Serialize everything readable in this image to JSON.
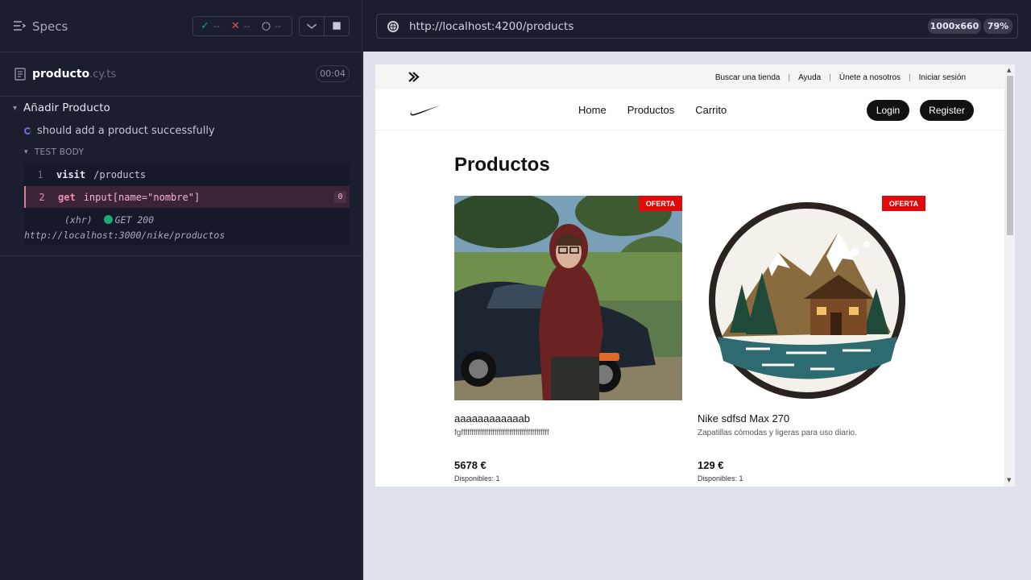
{
  "runner": {
    "specs_label": "Specs",
    "stats": {
      "passed": "--",
      "failed": "--",
      "pending": "--"
    },
    "file": {
      "name": "producto",
      "ext": ".cy.ts",
      "duration": "00:04"
    },
    "suite_title": "Añadir Producto",
    "test_title": "should add a product successfully",
    "test_body_label": "TEST BODY",
    "commands": [
      {
        "num": "1",
        "name": "visit",
        "arg": "/products"
      },
      {
        "num": "2",
        "name": "get",
        "arg": "input[name=\"nombre\"]",
        "count": "0"
      }
    ],
    "xhr": {
      "label": "(xhr)",
      "status": "GET 200",
      "url": "http://localhost:3000/nike/productos"
    }
  },
  "browser": {
    "url": "http://localhost:4200/products",
    "viewport": "1000x660",
    "zoom": "79%"
  },
  "site": {
    "utility_links": [
      "Buscar una tienda",
      "Ayuda",
      "Únete a nosotros",
      "Iniciar sesión"
    ],
    "nav_links": [
      "Home",
      "Productos",
      "Carrito"
    ],
    "login_label": "Login",
    "register_label": "Register",
    "heading": "Productos",
    "products": [
      {
        "badge": "OFERTA",
        "name": "aaaaaaaaaaaab",
        "description": "fgffffffffffffffffffffffffffffffffffffffffff",
        "price": "5678 €",
        "stock": "Disponibles: 1"
      },
      {
        "badge": "OFERTA",
        "name": "Nike sdfsd Max 270",
        "description": "Zapatillas cómodas y ligeras para uso diario.",
        "price": "129 €",
        "stock": "Disponibles: 1"
      }
    ]
  },
  "colors": {
    "accent_fail": "#e57a9c",
    "pass": "#1fa971",
    "offer": "#e10a0a"
  }
}
